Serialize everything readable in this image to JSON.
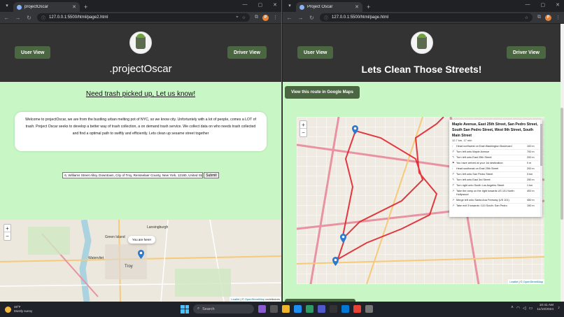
{
  "left_window": {
    "tab_title": "projectOscar",
    "url": "127.0.0.1:5500/html/page2.html",
    "nav": {
      "user_view": "User View",
      "driver_view": "Driver View"
    },
    "brand": ".projectOscar",
    "subheading": "Need trash picked up, Let us know!",
    "about_text": "Welcome to projectOscar, we are from the bustling urban melting pot of NYC, so we know city. Unfortuntely with a lot of people, comes a LOT of trash. Project Oscar seeks to develop a better way of trash collection, a on demand trash service. We collect data on who needs trash collected and find a optimal path to swiftly and efficiently. Lets clean up sesame street together",
    "address_value": "6, Williams Street Alley, Downtown, City of Troy, Rensselaer County, New York, 12180, United States",
    "submit_label": "Submit",
    "map": {
      "popup_text": "You are here!",
      "zoom_in": "+",
      "zoom_out": "−",
      "attribution_leaflet": "Leaflet",
      "attribution_sep": " | © ",
      "attribution_osm": "OpenStreetMap",
      "attribution_tail": " contributors",
      "labels": [
        "Watervliet",
        "Troy",
        "Lansingburgh",
        "Green Island"
      ]
    }
  },
  "right_window": {
    "tab_title": "Project Oscar",
    "url": "127.0.0.1:5500/html/page.html",
    "nav": {
      "user_view": "User View",
      "driver_view": "Driver View"
    },
    "page_title": "Lets Clean Those Streets!",
    "maps_button": "View this route in Google Maps",
    "map": {
      "zoom_in": "+",
      "zoom_out": "−",
      "attribution_leaflet": "Leaflet",
      "attribution_sep": " | © ",
      "attribution_osm": "OpenStreetMap"
    },
    "directions": {
      "title": "Maple Avenue, East 25th Street, San Pedro Street, South San Pedro Street, West 9th Street, South Main Street",
      "summary": "12.7 km, 17 min",
      "steps": [
        {
          "icon": "↑",
          "text": "Head northwest on East Washington Boulevard",
          "dist": "100 m"
        },
        {
          "icon": "↱",
          "text": "Turn left onto Maple Avenue",
          "dist": "700 m"
        },
        {
          "icon": "↰",
          "text": "Turn left onto East 25th Street",
          "dist": "200 m"
        },
        {
          "icon": "⚑",
          "text": "You have arrived at your 1st destination",
          "dist": "0 m"
        },
        {
          "icon": "↑",
          "text": "Head southeast on East 25th Street",
          "dist": "200 m"
        },
        {
          "icon": "↱",
          "text": "Turn left onto San Pedro Street",
          "dist": "3 km"
        },
        {
          "icon": "↰",
          "text": "Turn left onto East 3rd Street",
          "dist": "250 m"
        },
        {
          "icon": "↱",
          "text": "Turn right onto South Los Angeles Street",
          "dist": "1 km"
        },
        {
          "icon": "↗",
          "text": "Take the ramp on the right towards US 101 North: Hollywood",
          "dist": "400 m"
        },
        {
          "icon": "↗",
          "text": "Merge left onto Santa Ana Freeway (US 101)",
          "dist": "450 m"
        },
        {
          "icon": "↗",
          "text": "Take exit 3 towards I 110 South: San Pedro",
          "dist": "150 m"
        }
      ]
    }
  },
  "taskbar": {
    "weather_temp": "48°F",
    "weather_desc": "Mostly sunny",
    "search_placeholder": "Search",
    "time": "10:41 AM",
    "date": "11/10/2024"
  },
  "colors": {
    "page_bg": "#c8f7c5",
    "header_bg": "#333333",
    "button_green": "#4a6741",
    "route_red": "#e0242b",
    "marker_blue": "#2a7bd0"
  }
}
